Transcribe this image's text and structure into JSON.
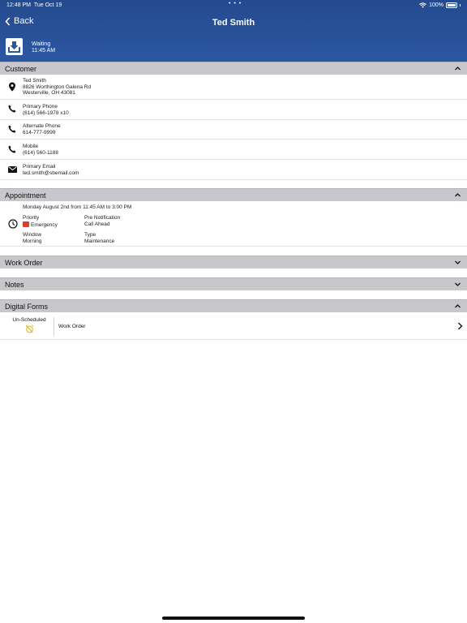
{
  "statusbar": {
    "time": "12:48 PM",
    "date": "Tue Oct 19",
    "dots": "• • •",
    "battery": "100%"
  },
  "header": {
    "back_label": "Back",
    "title": "Ted Smith",
    "status": "Waiting",
    "status_time": "11:45 AM"
  },
  "customer": {
    "title": "Customer",
    "name": "Ted Smith",
    "address1": "8826 Worthington Galena Rd",
    "address2": "Westerville, OH 43081",
    "phones": [
      {
        "label": "Primary Phone",
        "value": "(614) 566-1978 x10"
      },
      {
        "label": "Alternate Phone",
        "value": "614-777-9999"
      },
      {
        "label": "Mobile",
        "value": "(614) 560-1188"
      }
    ],
    "email_label": "Primary Email",
    "email": "ted.smith@sbemail.com"
  },
  "appointment": {
    "title": "Appointment",
    "date_range": "Monday August 2nd from 11:45 AM to 3:00 PM",
    "priority_label": "Priority",
    "priority_value": "Emergency",
    "pre_notification_label": "Pre Notification",
    "pre_notification_value": "Call Ahead",
    "window_label": "Window",
    "window_value": "Morning",
    "type_label": "Type",
    "type_value": "Maintenance"
  },
  "sections": {
    "work_order": "Work Order",
    "notes": "Notes",
    "digital_forms": "Digital Forms"
  },
  "digital_forms": {
    "status": "Un-Scheduled",
    "form_name": "Work Order"
  },
  "colors": {
    "header": "#2b57a2",
    "section_bg": "#c8c8cc",
    "emergency": "#e23b2e",
    "alarm": "#e0c020"
  }
}
